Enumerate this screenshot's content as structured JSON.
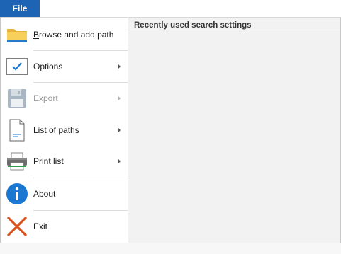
{
  "tab": {
    "label": "File"
  },
  "menu": {
    "items": [
      {
        "label": "Browse and add path",
        "icon": "folder-icon",
        "submenu": false,
        "disabled": false
      },
      {
        "label": "Options",
        "icon": "checkbox-icon",
        "submenu": true,
        "disabled": false
      },
      {
        "label": "Export",
        "icon": "floppy-disk-icon",
        "submenu": true,
        "disabled": true
      },
      {
        "label": "List of paths",
        "icon": "document-icon",
        "submenu": true,
        "disabled": false
      },
      {
        "label": "Print list",
        "icon": "printer-icon",
        "submenu": true,
        "disabled": false
      },
      {
        "label": "About",
        "icon": "info-icon",
        "submenu": false,
        "disabled": false
      },
      {
        "label": "Exit",
        "icon": "close-x-icon",
        "submenu": false,
        "disabled": false
      }
    ]
  },
  "recent": {
    "heading": "Recently used search settings"
  },
  "colors": {
    "accent": "#1e64b4",
    "info": "#1a78d2",
    "exit": "#d9531e"
  }
}
